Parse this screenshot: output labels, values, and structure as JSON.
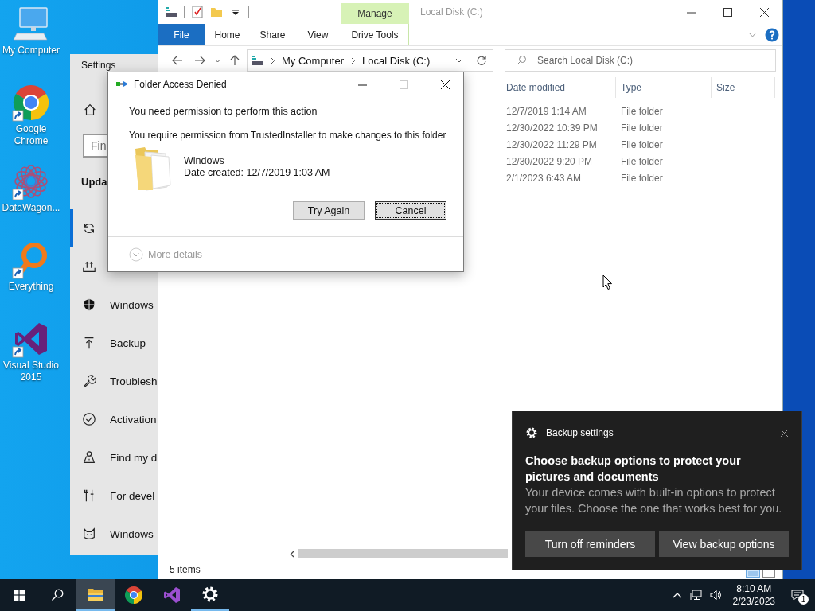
{
  "desktop_icons": [
    {
      "label": "My Computer",
      "kind": "computer",
      "shortcut": false
    },
    {
      "label": "Google Chrome",
      "kind": "chrome",
      "shortcut": true
    },
    {
      "label": "DataWagon...",
      "kind": "datawagon",
      "shortcut": true
    },
    {
      "label": "Everything",
      "kind": "everything",
      "shortcut": true
    },
    {
      "label": "Visual Studio 2015",
      "kind": "visual-studio",
      "shortcut": true
    }
  ],
  "settings": {
    "title": "Settings",
    "search": {
      "placeholder": "Fin"
    },
    "heading": "Upda",
    "items": [
      {
        "kind": "update",
        "selected": true
      },
      {
        "kind": "delivery",
        "selected": false
      },
      {
        "kind": "security",
        "label": "Windows",
        "selected": false
      },
      {
        "kind": "backup",
        "label": "Backup",
        "selected": false
      },
      {
        "kind": "troubleshoot",
        "label": "Troublesh",
        "selected": false
      },
      {
        "kind": "activation",
        "label": "Activation",
        "selected": false
      },
      {
        "kind": "find-device",
        "label": "Find my d",
        "selected": false
      },
      {
        "kind": "developers",
        "label": "For devel",
        "selected": false
      },
      {
        "kind": "insider",
        "label": "Windows",
        "selected": false
      }
    ]
  },
  "explorer": {
    "title": "Local Disk (C:)",
    "context_group": "Manage",
    "tabs": [
      {
        "label": "File",
        "kind": "file"
      },
      {
        "label": "Home",
        "kind": "tab"
      },
      {
        "label": "Share",
        "kind": "tab"
      },
      {
        "label": "View",
        "kind": "tab"
      },
      {
        "label": "Drive Tools",
        "kind": "context"
      }
    ],
    "breadcrumb": [
      "My Computer",
      "Local Disk (C:)"
    ],
    "search": {
      "placeholder": "Search Local Disk (C:)"
    },
    "columns": [
      "Date modified",
      "Type",
      "Size"
    ],
    "rows": [
      {
        "date_modified": "12/7/2019 1:14 AM",
        "type": "File folder"
      },
      {
        "date_modified": "12/30/2022 10:39 PM",
        "type": "File folder"
      },
      {
        "date_modified": "12/30/2022 11:29 PM",
        "type": "File folder"
      },
      {
        "date_modified": "12/30/2022 9:20 PM",
        "type": "File folder"
      },
      {
        "date_modified": "2/1/2023 6:43 AM",
        "type": "File folder"
      }
    ],
    "status_bar": "5 items"
  },
  "dialog": {
    "title": "Folder Access Denied",
    "heading": "You need permission to perform this action",
    "message": "You require permission from TrustedInstaller to make changes to this folder",
    "item_name": "Windows",
    "item_detail": "Date created: 12/7/2019 1:03 AM",
    "buttons": [
      {
        "label": "Try Again",
        "focused": false
      },
      {
        "label": "Cancel",
        "focused": true
      }
    ],
    "details": "More details"
  },
  "toast": {
    "app": "Backup settings",
    "title": "Choose backup options to protect your pictures and documents",
    "body": "Your device comes with built-in options to protect your files. Choose the one that works best for you.",
    "buttons": [
      "Turn off reminders",
      "View backup options"
    ]
  },
  "taskbar": {
    "apps": [
      {
        "kind": "explorer",
        "active": true,
        "running": true
      },
      {
        "kind": "chrome",
        "active": false,
        "running": false
      },
      {
        "kind": "visual-studio",
        "active": false,
        "running": false
      },
      {
        "kind": "settings",
        "active": false,
        "running": true
      }
    ],
    "time": "8:10 AM",
    "date": "2/23/2023",
    "notifications": "1"
  }
}
